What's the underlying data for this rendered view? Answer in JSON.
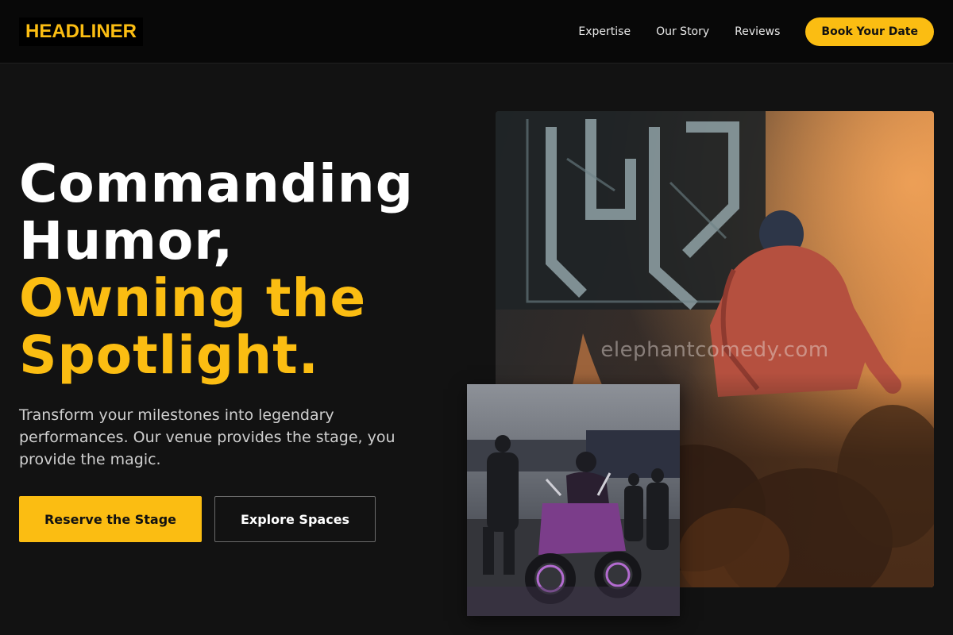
{
  "header": {
    "logo": "HEADLINER",
    "nav": [
      "Expertise",
      "Our Story",
      "Reviews"
    ],
    "cta": "Book Your Date"
  },
  "hero": {
    "title_line1": "Commanding",
    "title_line2": "Humor,",
    "title_line3": "Owning the",
    "title_line4": "Spotlight.",
    "subtitle": "Transform your milestones into legendary performances. Our venue provides the stage, you provide the magic.",
    "primary_button": "Reserve the Stage",
    "secondary_button": "Explore Spaces"
  },
  "images": {
    "main_watermark": "elephantcomedy.com"
  },
  "colors": {
    "accent": "#fbbd12",
    "background": "#121212",
    "header_background": "#080808"
  }
}
